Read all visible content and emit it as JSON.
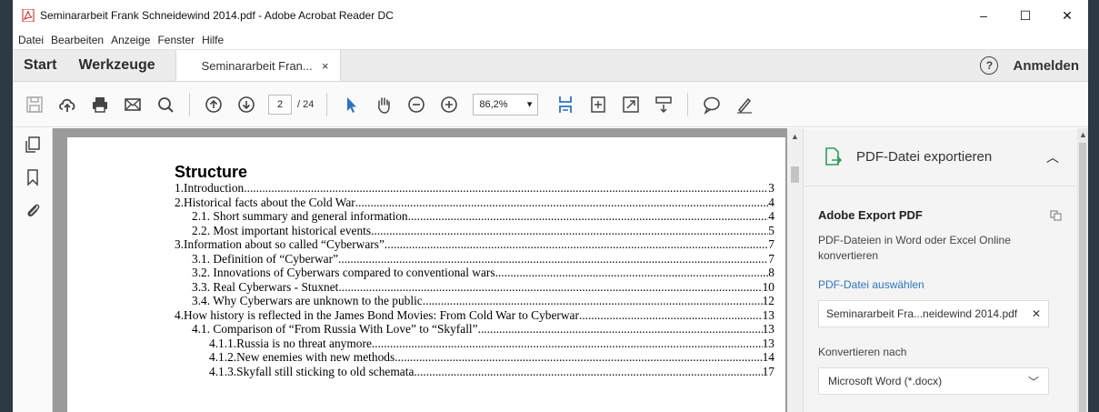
{
  "window": {
    "title": "Seminararbeit Frank Schneidewind 2014.pdf - Adobe Acrobat Reader DC",
    "minimize": "–",
    "maximize": "☐",
    "close": "✕"
  },
  "menu": [
    "Datei",
    "Bearbeiten",
    "Anzeige",
    "Fenster",
    "Hilfe"
  ],
  "tabs": {
    "start": "Start",
    "tools": "Werkzeuge",
    "document": "Seminararbeit Fran...",
    "document_close": "×",
    "help": "?",
    "sign_in": "Anmelden"
  },
  "toolbar": {
    "current_page": "2",
    "total_pages": "/ 24",
    "zoom": "86,2%",
    "icons": [
      "save-icon",
      "upload-cloud-icon",
      "print-icon",
      "email-icon",
      "search-icon",
      "page-up-icon",
      "page-down-icon",
      "select-arrow-icon",
      "hand-icon",
      "zoom-out-icon",
      "zoom-in-icon",
      "fit-width-icon",
      "fit-page-icon",
      "fullscreen-icon",
      "read-mode-icon",
      "comment-icon",
      "sign-icon"
    ]
  },
  "document": {
    "heading": "Structure",
    "toc": [
      {
        "level": 1,
        "text": "1.Introduction",
        "page": "3"
      },
      {
        "level": 1,
        "text": "2.Historical facts about the Cold War",
        "page": "4"
      },
      {
        "level": 2,
        "text": "2.1. Short summary and general information",
        "page": "4"
      },
      {
        "level": 2,
        "text": "2.2. Most important historical events",
        "page": "5"
      },
      {
        "level": 1,
        "text": "3.Information about so called “Cyberwars”",
        "page": "7"
      },
      {
        "level": 2,
        "text": "3.1. Definition of “Cyberwar”",
        "page": "7"
      },
      {
        "level": 2,
        "text": "3.2. Innovations of Cyberwars compared to conventional wars",
        "page": "8"
      },
      {
        "level": 2,
        "text": "3.3. Real Cyberwars - Stuxnet",
        "page": "10"
      },
      {
        "level": 2,
        "text": "3.4. Why Cyberwars are unknown to the public",
        "page": "12"
      },
      {
        "level": 1,
        "text": "4.How history is reflected in the James Bond Movies: From Cold War to Cyberwar",
        "page": "13"
      },
      {
        "level": 2,
        "text": "4.1. Comparison of “From Russia With Love” to “Skyfall”",
        "page": "13"
      },
      {
        "level": 3,
        "text": "4.1.1.Russia is no threat anymore",
        "page": "13"
      },
      {
        "level": 3,
        "text": "4.1.2.New enemies with new methods",
        "page": "14"
      },
      {
        "level": 3,
        "text": "4.1.3.Skyfall still sticking to old schemata",
        "page": "17"
      }
    ]
  },
  "export_panel": {
    "title": "PDF-Datei exportieren",
    "caret": "^",
    "service": "Adobe Export PDF",
    "description": "PDF-Dateien in Word oder Excel Online konvertieren",
    "select_link": "PDF-Datei auswählen",
    "file_name": "Seminararbeit Fra...neidewind 2014.pdf",
    "file_clear": "✕",
    "convert_label": "Konvertieren nach",
    "convert_value": "Microsoft Word (*.docx)",
    "accent_color": "#2d73c2",
    "export_icon_color": "#2e9e5a"
  }
}
